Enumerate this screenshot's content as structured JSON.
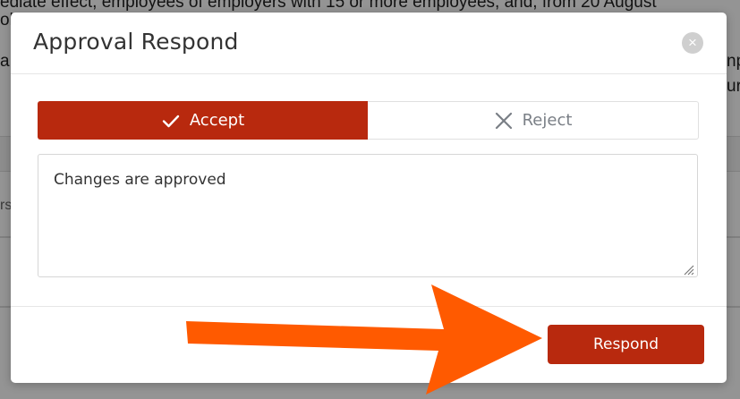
{
  "background": {
    "line1": "ediate effect, employees of employers with 15 or more employees, and, from 20 August",
    "line2": "ol",
    "frag_left": "a,",
    "frag_right1": "np",
    "frag_right2": "ur",
    "frag_left2": "rs"
  },
  "modal": {
    "title": "Approval Respond",
    "close_glyph": "×",
    "accept_label": "Accept",
    "reject_label": "Reject",
    "comment_value": "Changes are approved",
    "respond_label": "Respond"
  },
  "colors": {
    "accent": "#b8290e",
    "arrow": "#ff5a00"
  },
  "icons": {
    "accept": "check-icon",
    "reject": "x-icon",
    "close": "close-icon",
    "annotation": "arrow-right-icon"
  }
}
